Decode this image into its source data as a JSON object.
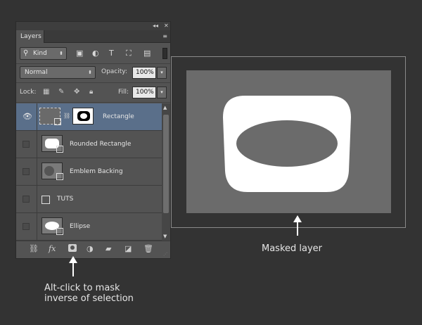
{
  "panel": {
    "title_controls": {
      "collapse": "◂◂",
      "close": "✕"
    },
    "tab": "Layers",
    "menu_icon": "≡",
    "filter": {
      "label": "Kind",
      "icons": [
        "image-filter-icon",
        "adjustment-filter-icon",
        "type-filter-icon",
        "shape-filter-icon",
        "smart-object-filter-icon"
      ]
    },
    "blend_mode": "Normal",
    "opacity_label": "Opacity:",
    "opacity_value": "100%",
    "lock_label": "Lock:",
    "fill_label": "Fill:",
    "fill_value": "100%",
    "layers": [
      {
        "name": "Rectangle",
        "visible": true,
        "selected": true
      },
      {
        "name": "Rounded Rectangle",
        "visible": false,
        "selected": false
      },
      {
        "name": "Emblem Backing",
        "visible": false,
        "selected": false
      },
      {
        "name": "TUTS",
        "visible": false,
        "selected": false
      },
      {
        "name": "Ellipse",
        "visible": false,
        "selected": false
      }
    ]
  },
  "annotations": {
    "masked_layer": "Masked layer",
    "alt_click_line1": "Alt-click to mask",
    "alt_click_line2": "inverse of selection"
  },
  "colors": {
    "background": "#333333",
    "panel": "#535353",
    "selected_layer": "#5a6f8a",
    "document": "#6b6b6b",
    "shape": "#ffffff"
  }
}
